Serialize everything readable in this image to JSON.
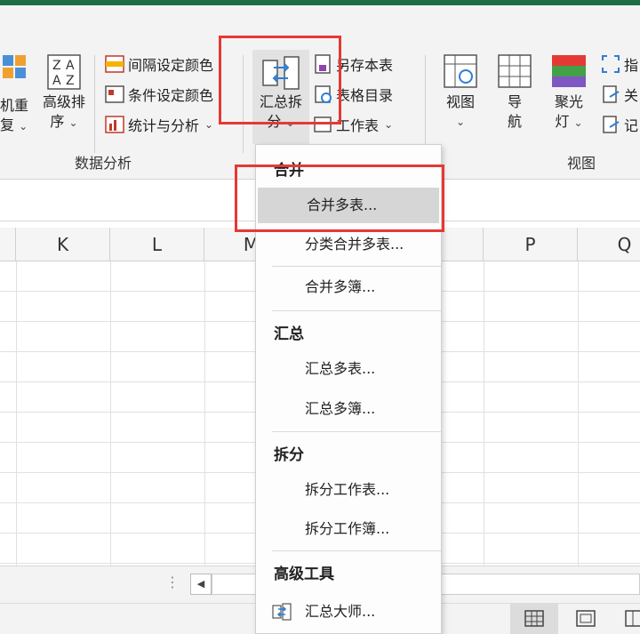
{
  "ribbon": {
    "left_partial_label": "机重\n复",
    "sort_label": "高级排\n序",
    "interval_color": "间隔设定颜色",
    "cond_color": "条件设定颜色",
    "stats": "统计与分析",
    "group_data": "数据分析",
    "summary_split": "汇总拆\n分",
    "save_as": "另存本表",
    "table_dir": "表格目录",
    "worksheet": "工作表",
    "view": "视图",
    "nav": "导\n航",
    "spotlight": "聚光\n灯",
    "group_view": "视图",
    "right_1": "指",
    "right_2": "关",
    "right_3": "记"
  },
  "columns": [
    "K",
    "L",
    "M",
    "",
    "P",
    "Q"
  ],
  "menu": {
    "sections": [
      {
        "title": "合并",
        "items": [
          "合并多表...",
          "分类合并多表...",
          "合并多簿..."
        ]
      },
      {
        "title": "汇总",
        "items": [
          "汇总多表...",
          "汇总多簿..."
        ]
      },
      {
        "title": "拆分",
        "items": [
          "拆分工作表...",
          "拆分工作簿..."
        ]
      },
      {
        "title": "高级工具",
        "items": [
          "汇总大师..."
        ]
      }
    ]
  },
  "colors": {
    "brand": "#1f6e43",
    "highlight": "#e53935",
    "active_item": "#d6d6d6"
  }
}
